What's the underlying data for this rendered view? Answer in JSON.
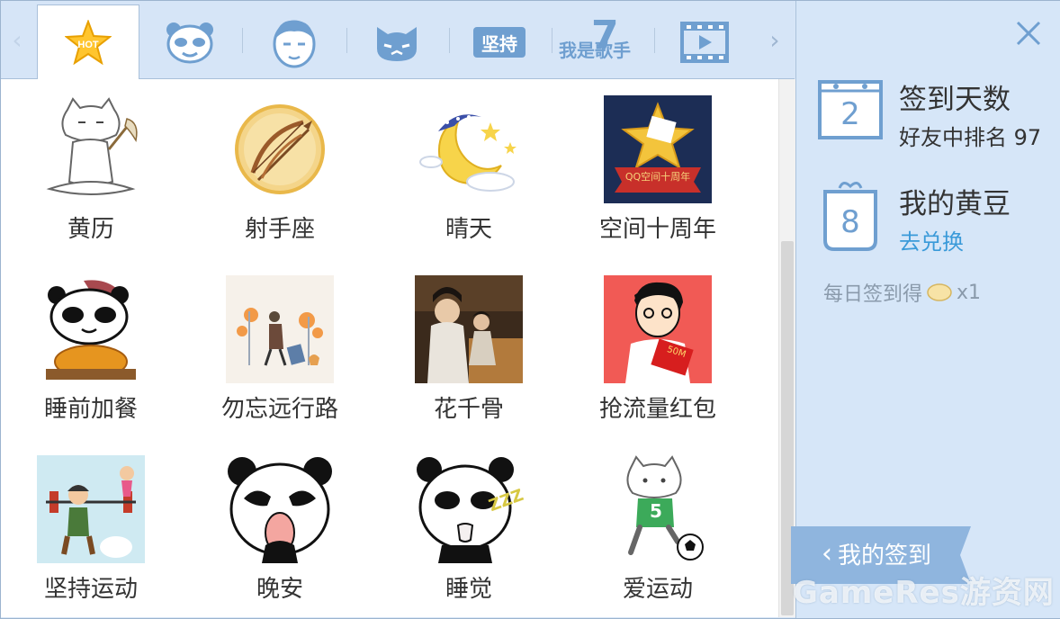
{
  "tabs": [
    {
      "id": "hot",
      "icon": "hot-star-icon",
      "badge": "HOT"
    },
    {
      "id": "panda",
      "icon": "panda-face-icon"
    },
    {
      "id": "boy",
      "icon": "boy-face-icon"
    },
    {
      "id": "cat",
      "icon": "cat-face-icon"
    },
    {
      "id": "persist",
      "icon": "persist-tag-icon",
      "label": "坚持"
    },
    {
      "id": "singer",
      "icon": "singer-logo-icon",
      "label": "我是歌手",
      "number": "7"
    },
    {
      "id": "video",
      "icon": "film-play-icon"
    }
  ],
  "items": [
    {
      "label": "黄历",
      "icon": "cat-meditating-icon"
    },
    {
      "label": "射手座",
      "icon": "sagittarius-bow-icon"
    },
    {
      "label": "晴天",
      "icon": "moon-stars-icon"
    },
    {
      "label": "空间十周年",
      "icon": "qzone-anniversary-icon",
      "banner": "QQ空间十周年"
    },
    {
      "label": "睡前加餐",
      "icon": "panda-turkey-icon"
    },
    {
      "label": "勿忘远行路",
      "icon": "traveler-autumn-icon"
    },
    {
      "label": "花千骨",
      "icon": "drama-still-icon"
    },
    {
      "label": "抢流量红包",
      "icon": "boy-red-envelope-icon",
      "envelope": "50M"
    },
    {
      "label": "坚持运动",
      "icon": "weightlifter-icon"
    },
    {
      "label": "晚安",
      "icon": "panda-yawn-icon"
    },
    {
      "label": "睡觉",
      "icon": "panda-sleep-icon",
      "zzz": "ZZZ"
    },
    {
      "label": "爱运动",
      "icon": "cat-soccer-icon",
      "jersey": "5"
    }
  ],
  "panel": {
    "checkin_days_value": "2",
    "checkin_days_title": "签到天数",
    "rank_text": "好友中排名 97",
    "beans_value": "8",
    "beans_title": "我的黄豆",
    "redeem_link": "去兑换",
    "daily_text": "每日签到得",
    "daily_count": "x1",
    "my_checkin": "我的签到"
  },
  "watermark": "GameRes游资网",
  "colors": {
    "accent": "#3a9ad9",
    "icon_blue": "#6f9fd0",
    "panel_bg": "#d6e6f8",
    "ribbon": "#8fb5de"
  }
}
